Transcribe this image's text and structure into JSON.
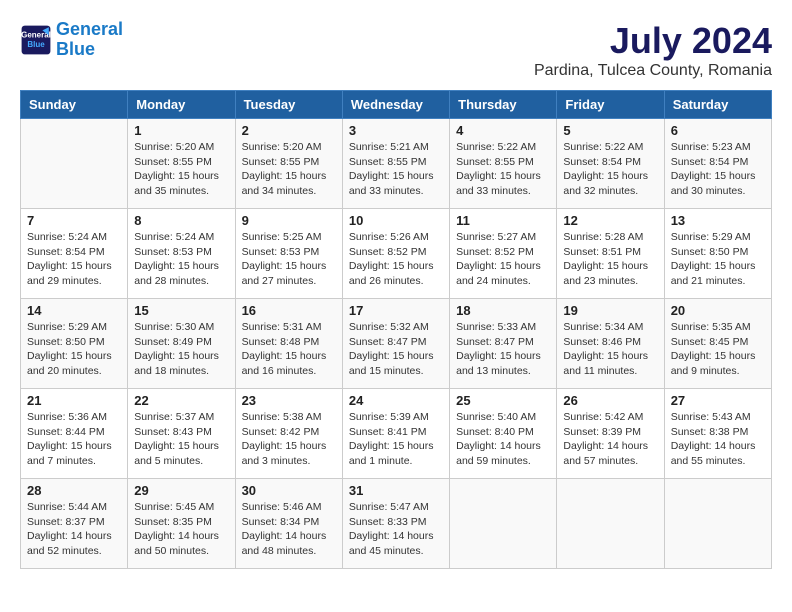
{
  "header": {
    "logo_line1": "General",
    "logo_line2": "Blue",
    "month": "July 2024",
    "location": "Pardina, Tulcea County, Romania"
  },
  "weekdays": [
    "Sunday",
    "Monday",
    "Tuesday",
    "Wednesday",
    "Thursday",
    "Friday",
    "Saturday"
  ],
  "weeks": [
    [
      {
        "day": "",
        "info": ""
      },
      {
        "day": "1",
        "info": "Sunrise: 5:20 AM\nSunset: 8:55 PM\nDaylight: 15 hours\nand 35 minutes."
      },
      {
        "day": "2",
        "info": "Sunrise: 5:20 AM\nSunset: 8:55 PM\nDaylight: 15 hours\nand 34 minutes."
      },
      {
        "day": "3",
        "info": "Sunrise: 5:21 AM\nSunset: 8:55 PM\nDaylight: 15 hours\nand 33 minutes."
      },
      {
        "day": "4",
        "info": "Sunrise: 5:22 AM\nSunset: 8:55 PM\nDaylight: 15 hours\nand 33 minutes."
      },
      {
        "day": "5",
        "info": "Sunrise: 5:22 AM\nSunset: 8:54 PM\nDaylight: 15 hours\nand 32 minutes."
      },
      {
        "day": "6",
        "info": "Sunrise: 5:23 AM\nSunset: 8:54 PM\nDaylight: 15 hours\nand 30 minutes."
      }
    ],
    [
      {
        "day": "7",
        "info": "Sunrise: 5:24 AM\nSunset: 8:54 PM\nDaylight: 15 hours\nand 29 minutes."
      },
      {
        "day": "8",
        "info": "Sunrise: 5:24 AM\nSunset: 8:53 PM\nDaylight: 15 hours\nand 28 minutes."
      },
      {
        "day": "9",
        "info": "Sunrise: 5:25 AM\nSunset: 8:53 PM\nDaylight: 15 hours\nand 27 minutes."
      },
      {
        "day": "10",
        "info": "Sunrise: 5:26 AM\nSunset: 8:52 PM\nDaylight: 15 hours\nand 26 minutes."
      },
      {
        "day": "11",
        "info": "Sunrise: 5:27 AM\nSunset: 8:52 PM\nDaylight: 15 hours\nand 24 minutes."
      },
      {
        "day": "12",
        "info": "Sunrise: 5:28 AM\nSunset: 8:51 PM\nDaylight: 15 hours\nand 23 minutes."
      },
      {
        "day": "13",
        "info": "Sunrise: 5:29 AM\nSunset: 8:50 PM\nDaylight: 15 hours\nand 21 minutes."
      }
    ],
    [
      {
        "day": "14",
        "info": "Sunrise: 5:29 AM\nSunset: 8:50 PM\nDaylight: 15 hours\nand 20 minutes."
      },
      {
        "day": "15",
        "info": "Sunrise: 5:30 AM\nSunset: 8:49 PM\nDaylight: 15 hours\nand 18 minutes."
      },
      {
        "day": "16",
        "info": "Sunrise: 5:31 AM\nSunset: 8:48 PM\nDaylight: 15 hours\nand 16 minutes."
      },
      {
        "day": "17",
        "info": "Sunrise: 5:32 AM\nSunset: 8:47 PM\nDaylight: 15 hours\nand 15 minutes."
      },
      {
        "day": "18",
        "info": "Sunrise: 5:33 AM\nSunset: 8:47 PM\nDaylight: 15 hours\nand 13 minutes."
      },
      {
        "day": "19",
        "info": "Sunrise: 5:34 AM\nSunset: 8:46 PM\nDaylight: 15 hours\nand 11 minutes."
      },
      {
        "day": "20",
        "info": "Sunrise: 5:35 AM\nSunset: 8:45 PM\nDaylight: 15 hours\nand 9 minutes."
      }
    ],
    [
      {
        "day": "21",
        "info": "Sunrise: 5:36 AM\nSunset: 8:44 PM\nDaylight: 15 hours\nand 7 minutes."
      },
      {
        "day": "22",
        "info": "Sunrise: 5:37 AM\nSunset: 8:43 PM\nDaylight: 15 hours\nand 5 minutes."
      },
      {
        "day": "23",
        "info": "Sunrise: 5:38 AM\nSunset: 8:42 PM\nDaylight: 15 hours\nand 3 minutes."
      },
      {
        "day": "24",
        "info": "Sunrise: 5:39 AM\nSunset: 8:41 PM\nDaylight: 15 hours\nand 1 minute."
      },
      {
        "day": "25",
        "info": "Sunrise: 5:40 AM\nSunset: 8:40 PM\nDaylight: 14 hours\nand 59 minutes."
      },
      {
        "day": "26",
        "info": "Sunrise: 5:42 AM\nSunset: 8:39 PM\nDaylight: 14 hours\nand 57 minutes."
      },
      {
        "day": "27",
        "info": "Sunrise: 5:43 AM\nSunset: 8:38 PM\nDaylight: 14 hours\nand 55 minutes."
      }
    ],
    [
      {
        "day": "28",
        "info": "Sunrise: 5:44 AM\nSunset: 8:37 PM\nDaylight: 14 hours\nand 52 minutes."
      },
      {
        "day": "29",
        "info": "Sunrise: 5:45 AM\nSunset: 8:35 PM\nDaylight: 14 hours\nand 50 minutes."
      },
      {
        "day": "30",
        "info": "Sunrise: 5:46 AM\nSunset: 8:34 PM\nDaylight: 14 hours\nand 48 minutes."
      },
      {
        "day": "31",
        "info": "Sunrise: 5:47 AM\nSunset: 8:33 PM\nDaylight: 14 hours\nand 45 minutes."
      },
      {
        "day": "",
        "info": ""
      },
      {
        "day": "",
        "info": ""
      },
      {
        "day": "",
        "info": ""
      }
    ]
  ]
}
